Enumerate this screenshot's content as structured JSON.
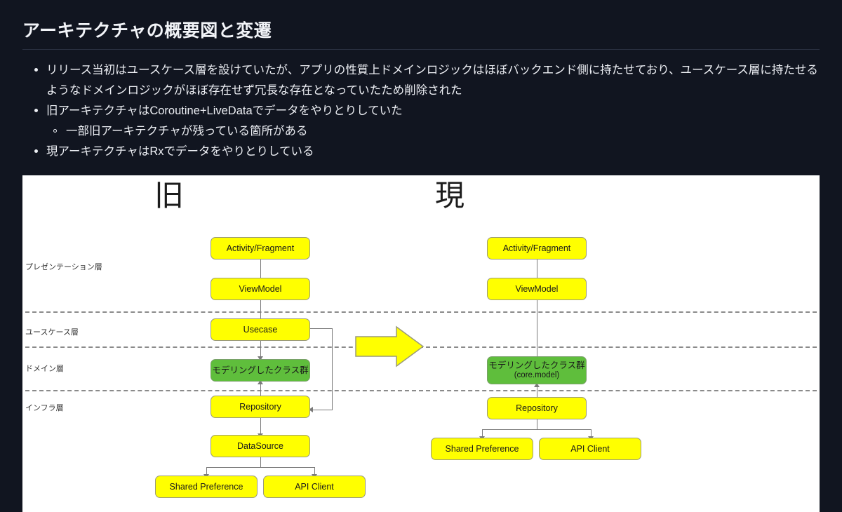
{
  "slide": {
    "title": "アーキテクチャの概要図と変遷",
    "bullets": [
      {
        "level": 1,
        "text": "リリース当初はユースケース層を設けていたが、アプリの性質上ドメインロジックはほぼバックエンド側に持たせており、ユースケース層に持たせるようなドメインロジックがほぼ存在せず冗長な存在となっていたため削除された"
      },
      {
        "level": 1,
        "text": "旧アーキテクチャはCoroutine+LiveDataでデータをやりとりしていた"
      },
      {
        "level": 2,
        "text": "一部旧アーキテクチャが残っている箇所がある"
      },
      {
        "level": 1,
        "text": "現アーキテクチャはRxでデータをやりとりしている"
      }
    ]
  },
  "diagram": {
    "column_headers": {
      "old": "旧",
      "new": "現"
    },
    "layers": [
      {
        "key": "presentation",
        "label": "プレゼンテーション層"
      },
      {
        "key": "usecase",
        "label": "ユースケース層"
      },
      {
        "key": "domain",
        "label": "ドメイン層"
      },
      {
        "key": "infra",
        "label": "インフラ層"
      }
    ],
    "transition_arrow": "right-arrow-icon",
    "old_nodes": [
      {
        "id": "activity",
        "label": "Activity/Fragment",
        "color": "#ffff00",
        "layer": "presentation"
      },
      {
        "id": "viewmodel",
        "label": "ViewModel",
        "color": "#ffff00",
        "layer": "presentation"
      },
      {
        "id": "usecase",
        "label": "Usecase",
        "color": "#ffff00",
        "layer": "usecase"
      },
      {
        "id": "model",
        "label": "モデリングしたクラス群",
        "color": "#5fbe3c",
        "layer": "domain"
      },
      {
        "id": "repository",
        "label": "Repository",
        "color": "#ffff00",
        "layer": "infra"
      },
      {
        "id": "datasource",
        "label": "DataSource",
        "color": "#ffff00",
        "layer": "infra"
      },
      {
        "id": "shared-preference",
        "label": "Shared Preference",
        "color": "#ffff00",
        "layer": "infra"
      },
      {
        "id": "api-client",
        "label": "API Client",
        "color": "#ffff00",
        "layer": "infra"
      }
    ],
    "new_nodes": [
      {
        "id": "activity",
        "label": "Activity/Fragment",
        "color": "#ffff00",
        "layer": "presentation"
      },
      {
        "id": "viewmodel",
        "label": "ViewModel",
        "color": "#ffff00",
        "layer": "presentation"
      },
      {
        "id": "model",
        "label": "モデリングしたクラス群",
        "sublabel": "(core.model)",
        "color": "#5fbe3c",
        "layer": "domain"
      },
      {
        "id": "repository",
        "label": "Repository",
        "color": "#ffff00",
        "layer": "infra"
      },
      {
        "id": "shared-preference",
        "label": "Shared Preference",
        "color": "#ffff00",
        "layer": "infra"
      },
      {
        "id": "api-client",
        "label": "API Client",
        "color": "#ffff00",
        "layer": "infra"
      }
    ]
  },
  "colors": {
    "background": "#111520",
    "panel": "#ffffff",
    "node_yellow": "#ffff00",
    "node_green": "#5fbe3c",
    "connector": "#7a7a7a",
    "divider": "#8a8a8a",
    "text_light": "#edeff4"
  }
}
